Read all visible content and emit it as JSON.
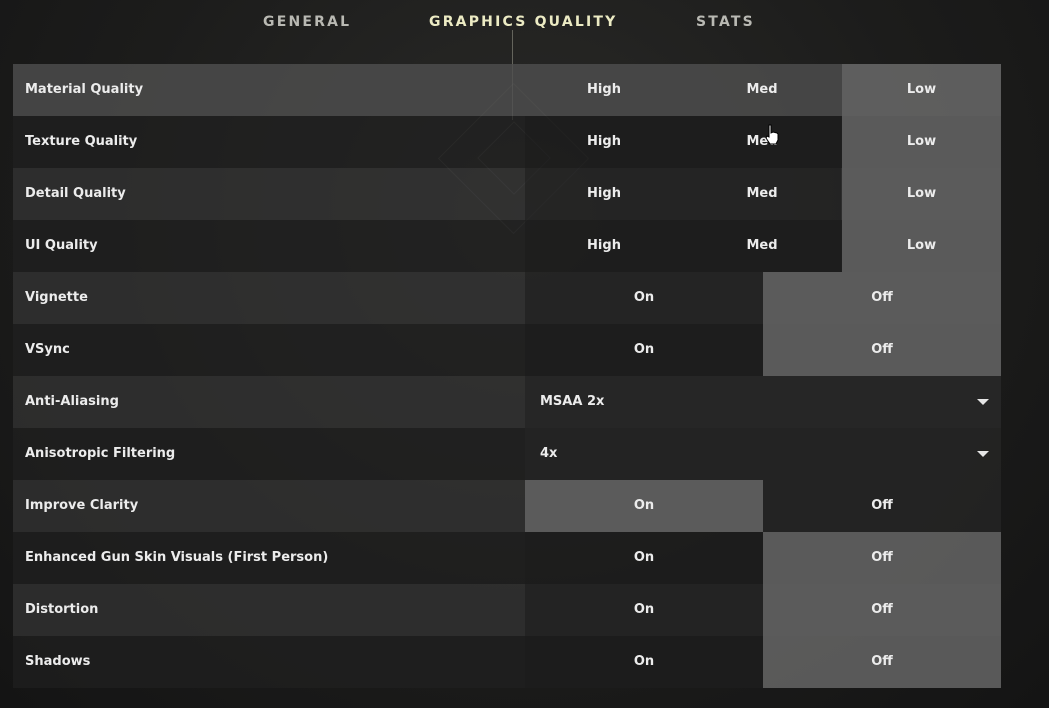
{
  "tabs": [
    {
      "label": "GENERAL"
    },
    {
      "label": "GRAPHICS QUALITY"
    },
    {
      "label": "STATS"
    }
  ],
  "active_tab": "GRAPHICS QUALITY",
  "rows": [
    {
      "label": "Material Quality",
      "options": [
        "High",
        "Med",
        "Low"
      ],
      "selected": "Low"
    },
    {
      "label": "Texture Quality",
      "options": [
        "High",
        "Med",
        "Low"
      ],
      "selected": "Low"
    },
    {
      "label": "Detail Quality",
      "options": [
        "High",
        "Med",
        "Low"
      ],
      "selected": "Low"
    },
    {
      "label": "UI Quality",
      "options": [
        "High",
        "Med",
        "Low"
      ],
      "selected": "Low"
    },
    {
      "label": "Vignette",
      "options": [
        "On",
        "Off"
      ],
      "selected": "Off"
    },
    {
      "label": "VSync",
      "options": [
        "On",
        "Off"
      ],
      "selected": "Off"
    },
    {
      "label": "Anti-Aliasing",
      "value": "MSAA 2x"
    },
    {
      "label": "Anisotropic Filtering",
      "value": "4x"
    },
    {
      "label": "Improve Clarity",
      "options": [
        "On",
        "Off"
      ],
      "selected": "On"
    },
    {
      "label": "Enhanced Gun Skin Visuals (First Person)",
      "options": [
        "On",
        "Off"
      ],
      "selected": "Off"
    },
    {
      "label": "Distortion",
      "options": [
        "On",
        "Off"
      ],
      "selected": "Off"
    },
    {
      "label": "Shadows",
      "options": [
        "On",
        "Off"
      ],
      "selected": "Off"
    }
  ],
  "colors": {
    "active_tab": "#ecebc4",
    "selected_option": "#606060"
  }
}
